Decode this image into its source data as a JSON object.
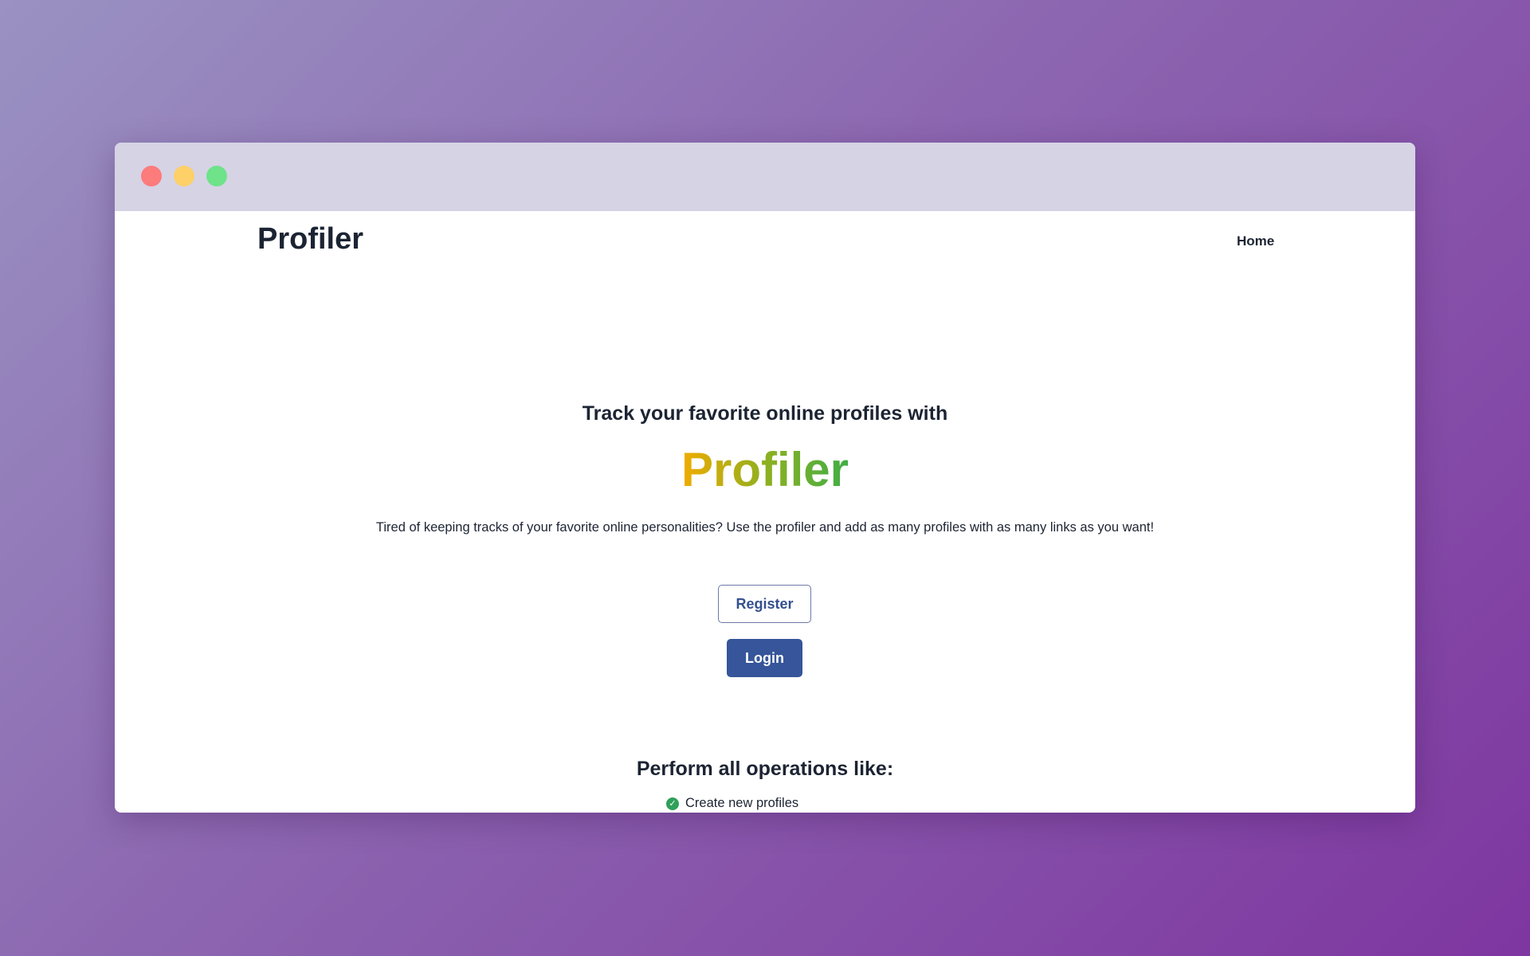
{
  "window": {
    "controls": [
      {
        "name": "close",
        "color": "#fc7b7b"
      },
      {
        "name": "minimize",
        "color": "#fdd068"
      },
      {
        "name": "maximize",
        "color": "#6ee38a"
      }
    ]
  },
  "header": {
    "brand": "Profiler",
    "nav": [
      {
        "label": "Home"
      }
    ]
  },
  "hero": {
    "heading": "Track your favorite online profiles with",
    "brand": "Profiler",
    "description": "Tired of keeping tracks of your favorite online personalities? Use the profiler and add as many profiles with as many links as you want!",
    "register_label": "Register",
    "login_label": "Login"
  },
  "features": {
    "heading": "Perform all operations like:",
    "items": [
      {
        "label": "Create new profiles",
        "icon": "check-circle-icon"
      }
    ]
  }
}
